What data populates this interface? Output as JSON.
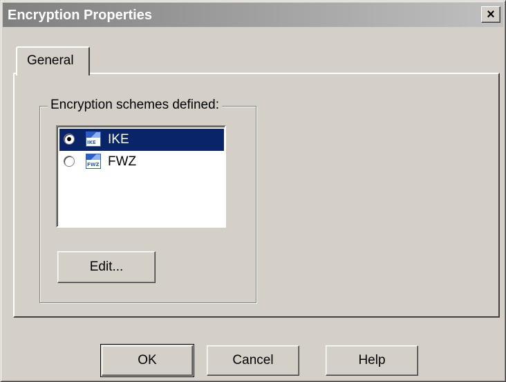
{
  "window": {
    "title": "Encryption Properties",
    "close_label": "×"
  },
  "tabs": [
    {
      "label": "General",
      "active": true
    }
  ],
  "group": {
    "legend": "Encryption schemes defined:"
  },
  "schemes": [
    {
      "label": "IKE",
      "icon": "ike-scheme-icon",
      "icon_text": "IKE",
      "selected": true
    },
    {
      "label": "FWZ",
      "icon": "fwz-scheme-icon",
      "icon_text": "FWZ",
      "selected": false
    }
  ],
  "buttons": {
    "edit": "Edit...",
    "ok": "OK",
    "cancel": "Cancel",
    "help": "Help"
  },
  "colors": {
    "selection": "#0a246a",
    "face": "#d4d0c8"
  }
}
